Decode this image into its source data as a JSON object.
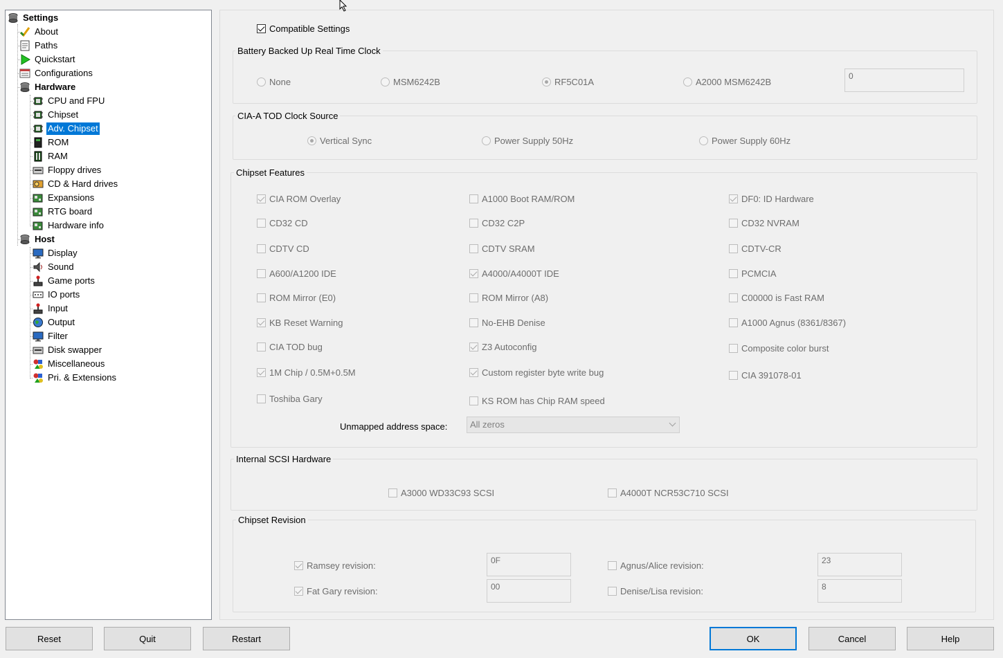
{
  "tree": {
    "root": {
      "label": "Settings",
      "icon": "disk-icon"
    },
    "items": [
      {
        "label": "About",
        "icon": "checkmark-icon",
        "level": 1
      },
      {
        "label": "Paths",
        "icon": "document-icon",
        "level": 1
      },
      {
        "label": "Quickstart",
        "icon": "play-icon",
        "level": 1
      },
      {
        "label": "Configurations",
        "icon": "list-icon",
        "level": 1
      },
      {
        "label": "Hardware",
        "icon": "disk-icon",
        "level": 1,
        "bold": true
      },
      {
        "label": "CPU and FPU",
        "icon": "chip-icon",
        "level": 2
      },
      {
        "label": "Chipset",
        "icon": "chip-icon",
        "level": 2
      },
      {
        "label": "Adv. Chipset",
        "icon": "chip-icon",
        "level": 2,
        "selected": true
      },
      {
        "label": "ROM",
        "icon": "rom-icon",
        "level": 2
      },
      {
        "label": "RAM",
        "icon": "ram-icon",
        "level": 2
      },
      {
        "label": "Floppy drives",
        "icon": "floppy-drive-icon",
        "level": 2
      },
      {
        "label": "CD & Hard drives",
        "icon": "hard-drive-icon",
        "level": 2
      },
      {
        "label": "Expansions",
        "icon": "board-icon",
        "level": 2
      },
      {
        "label": "RTG board",
        "icon": "board-icon",
        "level": 2
      },
      {
        "label": "Hardware info",
        "icon": "board-icon",
        "level": 2
      },
      {
        "label": "Host",
        "icon": "disk-icon",
        "level": 1,
        "bold": true
      },
      {
        "label": "Display",
        "icon": "monitor-icon",
        "level": 2
      },
      {
        "label": "Sound",
        "icon": "speaker-icon",
        "level": 2
      },
      {
        "label": "Game ports",
        "icon": "joystick-icon",
        "level": 2
      },
      {
        "label": "IO ports",
        "icon": "port-icon",
        "level": 2
      },
      {
        "label": "Input",
        "icon": "joystick-icon",
        "level": 2
      },
      {
        "label": "Output",
        "icon": "globe-icon",
        "level": 2
      },
      {
        "label": "Filter",
        "icon": "monitor-icon",
        "level": 2
      },
      {
        "label": "Disk swapper",
        "icon": "floppy-drive-icon",
        "level": 2
      },
      {
        "label": "Miscellaneous",
        "icon": "shapes-icon",
        "level": 2
      },
      {
        "label": "Pri. & Extensions",
        "icon": "shapes-icon",
        "level": 2
      }
    ]
  },
  "compatible": {
    "label": "Compatible Settings",
    "checked": true
  },
  "rtc": {
    "title": "Battery Backed Up Real Time Clock",
    "options": [
      {
        "label": "None",
        "checked": false
      },
      {
        "label": "MSM6242B",
        "checked": false
      },
      {
        "label": "RF5C01A",
        "checked": true
      },
      {
        "label": "A2000 MSM6242B",
        "checked": false
      }
    ],
    "value": "0"
  },
  "tod": {
    "title": "CIA-A TOD Clock Source",
    "options": [
      {
        "label": "Vertical Sync",
        "checked": true
      },
      {
        "label": "Power Supply 50Hz",
        "checked": false
      },
      {
        "label": "Power Supply 60Hz",
        "checked": false
      }
    ]
  },
  "features": {
    "title": "Chipset Features",
    "col1": [
      {
        "label": "CIA ROM Overlay",
        "checked": true
      },
      {
        "label": "CD32 CD",
        "checked": false
      },
      {
        "label": "CDTV CD",
        "checked": false
      },
      {
        "label": "A600/A1200 IDE",
        "checked": false
      },
      {
        "label": "ROM Mirror (E0)",
        "checked": false
      },
      {
        "label": "KB Reset Warning",
        "checked": true
      },
      {
        "label": "CIA TOD bug",
        "checked": false
      },
      {
        "label": "1M Chip / 0.5M+0.5M",
        "checked": true
      },
      {
        "label": "Toshiba Gary",
        "checked": false
      }
    ],
    "col2": [
      {
        "label": "A1000 Boot RAM/ROM",
        "checked": false
      },
      {
        "label": "CD32 C2P",
        "checked": false
      },
      {
        "label": "CDTV SRAM",
        "checked": false
      },
      {
        "label": "A4000/A4000T IDE",
        "checked": true
      },
      {
        "label": "ROM Mirror (A8)",
        "checked": false
      },
      {
        "label": "No-EHB Denise",
        "checked": false
      },
      {
        "label": "Z3 Autoconfig",
        "checked": true
      },
      {
        "label": "Custom register byte write bug",
        "checked": true
      },
      {
        "label": "KS ROM has Chip RAM speed",
        "checked": false
      }
    ],
    "col3": [
      {
        "label": "DF0: ID Hardware",
        "checked": true
      },
      {
        "label": "CD32 NVRAM",
        "checked": false
      },
      {
        "label": "CDTV-CR",
        "checked": false
      },
      {
        "label": "PCMCIA",
        "checked": false
      },
      {
        "label": "C00000 is Fast RAM",
        "checked": false
      },
      {
        "label": "A1000 Agnus (8361/8367)",
        "checked": false
      },
      {
        "label": "Composite color burst",
        "checked": false
      },
      {
        "label": "CIA 391078-01",
        "checked": false
      }
    ],
    "unmapped_label": "Unmapped address space:",
    "unmapped_value": "All zeros"
  },
  "scsi": {
    "title": "Internal SCSI Hardware",
    "options": [
      {
        "label": "A3000 WD33C93 SCSI",
        "checked": false
      },
      {
        "label": "A4000T NCR53C710 SCSI",
        "checked": false
      }
    ]
  },
  "revision": {
    "title": "Chipset Revision",
    "ramsey": {
      "label": "Ramsey revision:",
      "checked": true,
      "value": "0F"
    },
    "fatgary": {
      "label": "Fat Gary revision:",
      "checked": true,
      "value": "00"
    },
    "agnus": {
      "label": "Agnus/Alice revision:",
      "checked": false,
      "value": "23"
    },
    "denise": {
      "label": "Denise/Lisa revision:",
      "checked": false,
      "value": "8"
    }
  },
  "buttons": {
    "reset": "Reset",
    "quit": "Quit",
    "restart": "Restart",
    "ok": "OK",
    "cancel": "Cancel",
    "help": "Help"
  },
  "colors": {
    "selection": "#0078d7",
    "background": "#f0f0f0"
  }
}
